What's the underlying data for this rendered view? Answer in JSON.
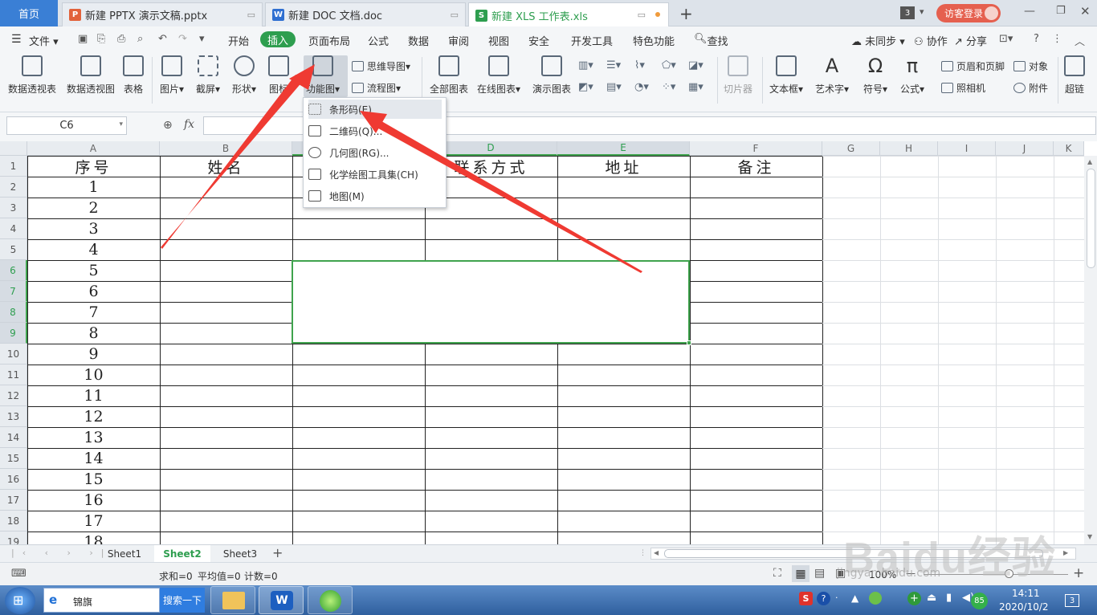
{
  "tabs": {
    "home": "首页",
    "pptx": "新建 PPTX 演示文稿.pptx",
    "doc": "新建 DOC 文档.doc",
    "xls": "新建 XLS 工作表.xls",
    "new_tab": "+",
    "window_count": "3",
    "login": "访客登录"
  },
  "menu": {
    "file": "文件",
    "items": [
      "开始",
      "插入",
      "页面布局",
      "公式",
      "数据",
      "审阅",
      "视图",
      "安全",
      "开发工具",
      "特色功能",
      "查找"
    ],
    "unsync": "未同步",
    "collab": "协作",
    "share": "分享"
  },
  "ribbon": {
    "big": [
      "数据透视表",
      "数据透视图",
      "表格",
      "图片",
      "截屏",
      "形状",
      "图标",
      "功能图",
      "全部图表",
      "在线图表",
      "演示图表",
      "切片器",
      "文本框",
      "艺术字",
      "符号",
      "公式",
      "超链"
    ],
    "mindmap": "思维导图",
    "flowchart": "流程图",
    "header_footer": "页眉和页脚",
    "object": "对象",
    "camera": "照相机",
    "attachment": "附件"
  },
  "dropdown": {
    "items": [
      "条形码(E)",
      "二维码(Q)...",
      "几何图(RG)...",
      "化学绘图工具集(CH)",
      "地图(M)"
    ]
  },
  "formula_bar": {
    "cell_ref": "C6",
    "fx": "fx"
  },
  "grid": {
    "columns": [
      "A",
      "B",
      "C",
      "D",
      "E",
      "F",
      "G",
      "H",
      "I",
      "J",
      "K"
    ],
    "rows": [
      "1",
      "2",
      "3",
      "4",
      "5",
      "6",
      "7",
      "8",
      "9",
      "10",
      "11",
      "12",
      "13",
      "14",
      "15",
      "16",
      "17",
      "18",
      "19"
    ],
    "header_row": [
      "序号",
      "姓名",
      "",
      "联系方式",
      "地址",
      "备注"
    ],
    "col_a_values": [
      "1",
      "2",
      "3",
      "4",
      "5",
      "6",
      "7",
      "8",
      "9",
      "10",
      "11",
      "12",
      "13",
      "14",
      "15",
      "16",
      "17",
      "18"
    ]
  },
  "sheets": [
    "Sheet1",
    "Sheet2",
    "Sheet3"
  ],
  "status": {
    "sum": "求和=0",
    "avg": "平均值=0",
    "count": "计数=0",
    "zoom": "100%"
  },
  "taskbar": {
    "search_text": "锦旗",
    "search_button": "搜索一下",
    "battery": "85",
    "time": "14:11",
    "date": "2020/10/2",
    "win_count": "3"
  },
  "watermark": {
    "brand": "Baidu经验",
    "url": "jingyan.baidu.com"
  },
  "colors": {
    "accent_green": "#2e9e4f",
    "home_blue": "#3a7fd5",
    "annotation_red": "#ef3a32"
  }
}
